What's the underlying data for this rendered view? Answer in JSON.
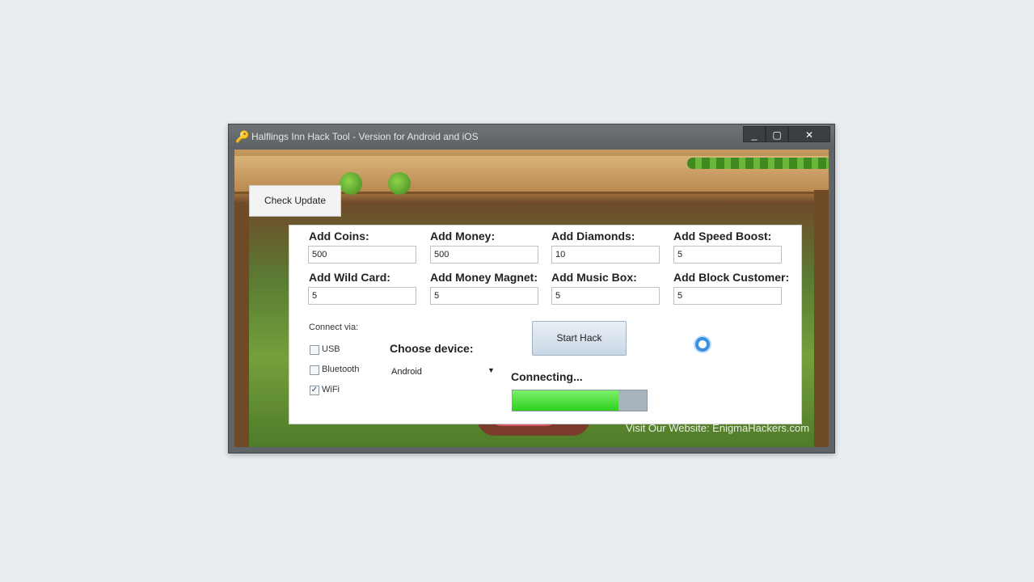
{
  "window": {
    "title": "Halflings Inn Hack Tool - Version for Android and iOS",
    "controls": {
      "minimize": "_",
      "maximize": "▢",
      "close": "✕"
    }
  },
  "toolbar": {
    "check_update_label": "Check Update"
  },
  "fields": [
    {
      "label": "Add Coins:",
      "value": "500"
    },
    {
      "label": "Add Money:",
      "value": "500"
    },
    {
      "label": "Add Diamonds:",
      "value": "10"
    },
    {
      "label": "Add Speed Boost:",
      "value": "5"
    },
    {
      "label": "Add Wild Card:",
      "value": "5"
    },
    {
      "label": "Add Money Magnet:",
      "value": "5"
    },
    {
      "label": "Add Music Box:",
      "value": "5"
    },
    {
      "label": "Add Block Customer:",
      "value": "5"
    }
  ],
  "connect": {
    "label": "Connect via:",
    "options": [
      {
        "label": "USB",
        "checked": false
      },
      {
        "label": "Bluetooth",
        "checked": false
      },
      {
        "label": "WiFi",
        "checked": true
      }
    ]
  },
  "device": {
    "label": "Choose device:",
    "selected": "Android"
  },
  "actions": {
    "start_hack_label": "Start Hack"
  },
  "status": {
    "text": "Connecting...",
    "progress": 0.79
  },
  "footer": {
    "website": "Visit Our Website: EnigmaHackers.com"
  },
  "colors": {
    "progress_fill": "#2fd11f",
    "progress_track": "#a7b3bd",
    "spinner": "#3d8fe0"
  },
  "icons": {
    "app": "key-icon",
    "busy": "loading-spinner-icon"
  }
}
